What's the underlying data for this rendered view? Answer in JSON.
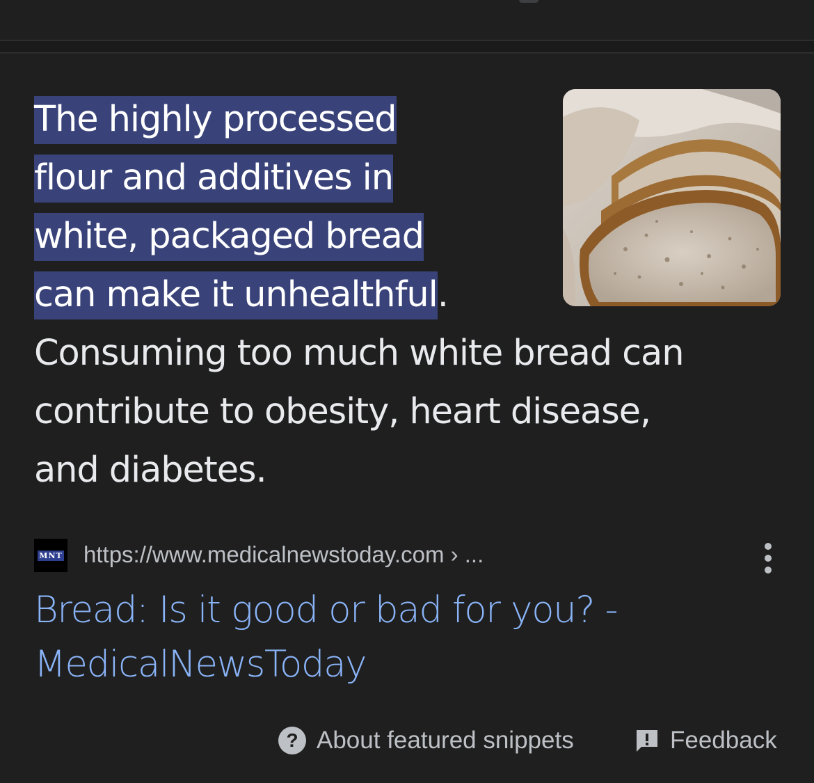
{
  "snippet": {
    "highlighted_lines": [
      "The highly processed",
      "flour and additives in",
      "white, packaged bread",
      "can make it unhealthful"
    ],
    "highlight_end_punct": ".",
    "rest_lines": [
      "Consuming too much white bread can",
      "contribute to obesity, heart disease,",
      "and diabetes."
    ]
  },
  "image": {
    "icon": "bread-photo"
  },
  "source": {
    "favicon_text": "MNT",
    "url": "https://www.medicalnewstoday.com › ...",
    "more_icon": "more-vert-icon"
  },
  "result": {
    "title_line1": "Bread: Is it good or bad for you? -",
    "title_line2": "MedicalNewsToday"
  },
  "footer": {
    "about_label": "About featured snippets",
    "about_icon": "?",
    "feedback_label": "Feedback"
  },
  "colors": {
    "background": "#1f1f1f",
    "highlight": "#394379",
    "link": "#8ab4f8",
    "text": "#e8eaed",
    "secondary": "#bdc1c6"
  }
}
